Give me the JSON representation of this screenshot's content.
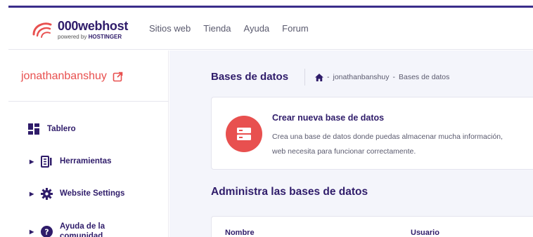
{
  "header": {
    "logo_title": "000webhost",
    "logo_powered_by": "powered by",
    "logo_brand": "HOSTINGER",
    "nav": [
      "Sitios web",
      "Tienda",
      "Ayuda",
      "Forum"
    ]
  },
  "sidebar": {
    "site_name": "jonathanbanshuy",
    "items": [
      {
        "label": "Tablero",
        "icon": "dashboard-icon",
        "expandable": false
      },
      {
        "label": "Herramientas",
        "icon": "tools-icon",
        "expandable": true
      },
      {
        "label": "Website Settings",
        "icon": "gear-icon",
        "expandable": true
      },
      {
        "label": "Ayuda de la comunidad",
        "icon": "help-icon",
        "expandable": true
      }
    ]
  },
  "main": {
    "page_title": "Bases de datos",
    "breadcrumb": [
      "jonathanbanshuy",
      "Bases de datos"
    ],
    "breadcrumb_separator": "-",
    "create_card": {
      "title": "Crear nueva base de datos",
      "description_line1": "Crea una base de datos donde puedas almacenar mucha información,",
      "description_line2": "web necesita para funcionar correctamente."
    },
    "section_title": "Administra las bases de datos",
    "table_headers": [
      "Nombre",
      "Usuario"
    ]
  },
  "colors": {
    "accent": "#e8504f",
    "brand": "#2f1c6a",
    "background": "#f4f5fb"
  }
}
